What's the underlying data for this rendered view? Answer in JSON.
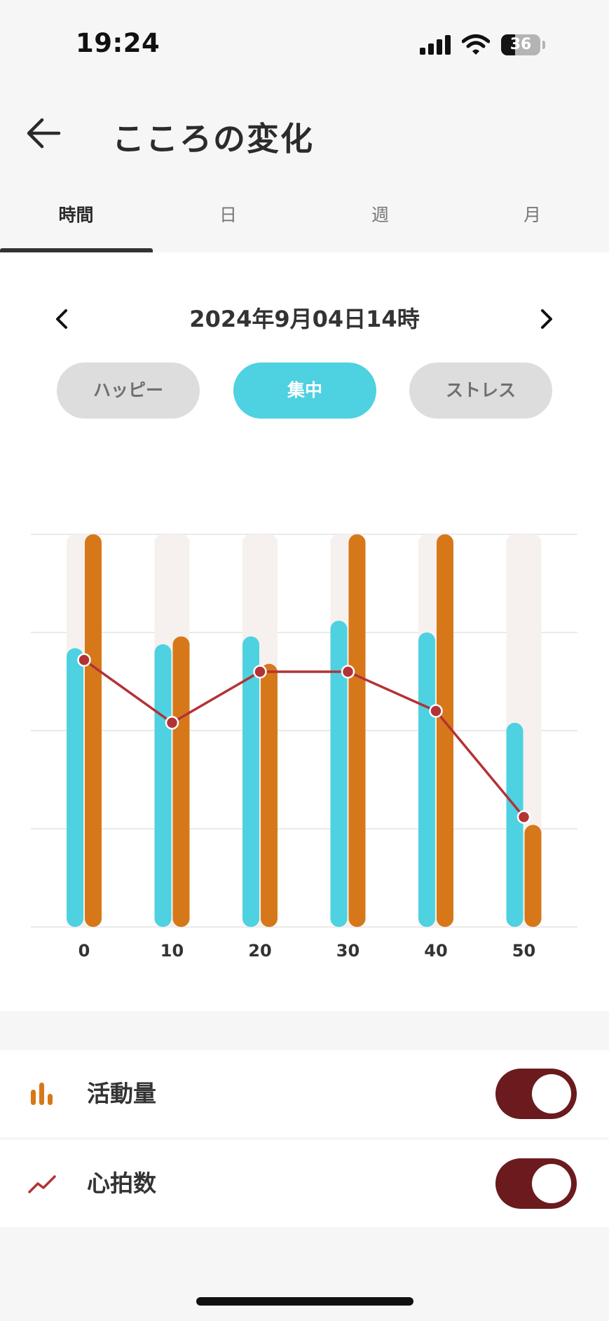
{
  "status_bar": {
    "time": "19:24",
    "battery_level": "36",
    "battery_fraction": 0.36,
    "icons": [
      "cellular-signal-icon",
      "wifi-icon",
      "battery-icon"
    ]
  },
  "header": {
    "title": "こころの変化",
    "back_icon": "arrow-left-icon"
  },
  "tabs": [
    {
      "label": "時間",
      "active": true
    },
    {
      "label": "日",
      "active": false
    },
    {
      "label": "週",
      "active": false
    },
    {
      "label": "月",
      "active": false
    }
  ],
  "date_nav": {
    "label": "2024年9月04日14時",
    "prev_icon": "chevron-left-icon",
    "next_icon": "chevron-right-icon"
  },
  "modes": [
    {
      "label": "ハッピー",
      "active": false
    },
    {
      "label": "集中",
      "active": true
    },
    {
      "label": "ストレス",
      "active": false
    }
  ],
  "chart_data": {
    "type": "bar",
    "categories": [
      "0",
      "10",
      "20",
      "30",
      "40",
      "50"
    ],
    "ylim": [
      0,
      100
    ],
    "grid": true,
    "series": [
      {
        "kind": "bar",
        "values": [
          71,
          72,
          74,
          78,
          75,
          52
        ],
        "color": "#4ed1e1"
      },
      {
        "kind": "bar",
        "values": [
          100,
          74,
          67,
          100,
          100,
          26
        ],
        "color": "#d67819"
      },
      {
        "kind": "line",
        "values": [
          68,
          52,
          65,
          65,
          55,
          28
        ],
        "color": "#b33236"
      }
    ],
    "background_bar_color": "#f6f1ee"
  },
  "legend": [
    {
      "label": "活動量",
      "icon": "bar-chart-icon",
      "color": "#d67819",
      "enabled": true
    },
    {
      "label": "心拍数",
      "icon": "line-chart-icon",
      "color": "#b33236",
      "enabled": true
    }
  ],
  "colors": {
    "accent": "#4ed1e1",
    "toggle_on": "#6b1a1e",
    "bar_orange": "#d67819",
    "line_red": "#b33236"
  }
}
